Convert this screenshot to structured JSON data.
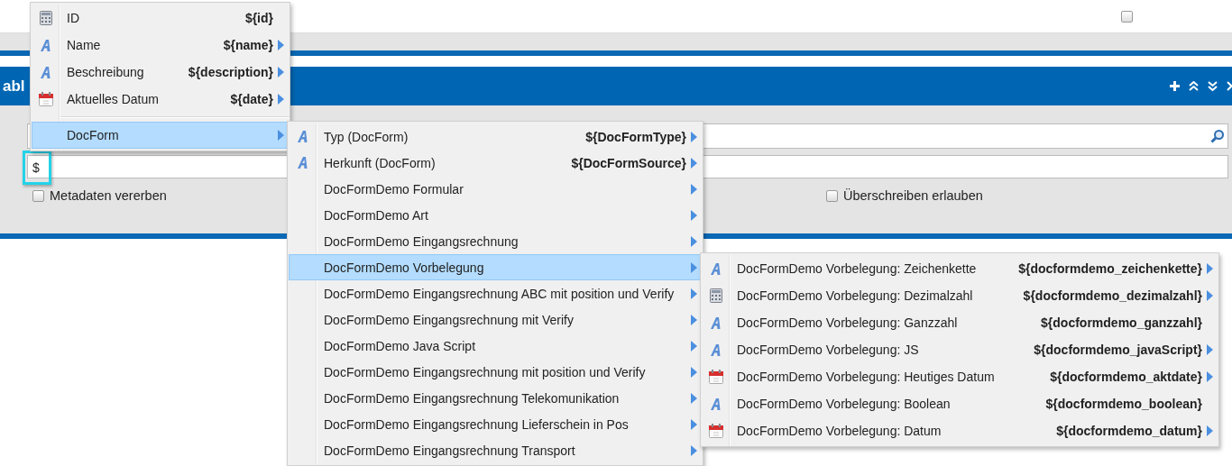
{
  "top_row": {
    "checked": false
  },
  "panel": {
    "title": "abl",
    "expression_field": {
      "value": "$",
      "focused": true
    },
    "checkboxes": [
      {
        "label": "Metadaten vererben",
        "checked": false
      },
      {
        "label": "Überschreiben erlauben",
        "checked": false
      }
    ]
  },
  "menus": [
    {
      "sections": [
        [
          {
            "kind": "number",
            "label": "ID",
            "value": "${id}",
            "has_submenu": false,
            "selected": false
          },
          {
            "kind": "text",
            "label": "Name",
            "value": "${name}",
            "has_submenu": true,
            "selected": false
          },
          {
            "kind": "text",
            "label": "Beschreibung",
            "value": "${description}",
            "has_submenu": true,
            "selected": false
          },
          {
            "kind": "date",
            "label": "Aktuelles Datum",
            "value": "${date}",
            "has_submenu": true,
            "selected": false
          }
        ],
        [
          {
            "kind": "group",
            "label": "DocForm",
            "has_submenu": true,
            "selected": true
          }
        ]
      ]
    },
    {
      "sections": [
        [
          {
            "kind": "text",
            "label": "Typ (DocForm)",
            "value": "${DocFormType}",
            "has_submenu": true,
            "selected": false
          },
          {
            "kind": "text",
            "label": "Herkunft (DocForm)",
            "value": "${DocFormSource}",
            "has_submenu": true,
            "selected": false
          },
          {
            "kind": "group",
            "label": "DocFormDemo Formular",
            "has_submenu": true,
            "selected": false
          },
          {
            "kind": "group",
            "label": "DocFormDemo Art",
            "has_submenu": true,
            "selected": false
          },
          {
            "kind": "group",
            "label": "DocFormDemo Eingangsrechnung",
            "has_submenu": true,
            "selected": false
          },
          {
            "kind": "group",
            "label": "DocFormDemo Vorbelegung",
            "has_submenu": true,
            "selected": true
          },
          {
            "kind": "group",
            "label": "DocFormDemo Eingangsrechnung ABC mit position und Verify",
            "has_submenu": true,
            "selected": false
          },
          {
            "kind": "group",
            "label": "DocFormDemo Eingangsrechnung mit Verify",
            "has_submenu": true,
            "selected": false
          },
          {
            "kind": "group",
            "label": "DocFormDemo Java Script",
            "has_submenu": true,
            "selected": false
          },
          {
            "kind": "group",
            "label": "DocFormDemo Eingangsrechnung mit position und Verify",
            "has_submenu": true,
            "selected": false
          },
          {
            "kind": "group",
            "label": "DocFormDemo Eingangsrechnung Telekomunikation",
            "has_submenu": true,
            "selected": false
          },
          {
            "kind": "group",
            "label": "DocFormDemo Eingangsrechnung Lieferschein in Pos",
            "has_submenu": true,
            "selected": false
          },
          {
            "kind": "group",
            "label": "DocFormDemo Eingangsrechnung Transport",
            "has_submenu": true,
            "selected": false
          }
        ]
      ]
    },
    {
      "sections": [
        [
          {
            "kind": "text",
            "label": "DocFormDemo Vorbelegung: Zeichenkette",
            "value": "${docformdemo_zeichenkette}",
            "has_submenu": true,
            "selected": false
          },
          {
            "kind": "number",
            "label": "DocFormDemo Vorbelegung: Dezimalzahl",
            "value": "${docformdemo_dezimalzahl}",
            "has_submenu": true,
            "selected": false
          },
          {
            "kind": "text",
            "label": "DocFormDemo Vorbelegung: Ganzzahl",
            "value": "${docformdemo_ganzzahl}",
            "has_submenu": false,
            "selected": false
          },
          {
            "kind": "text",
            "label": "DocFormDemo Vorbelegung: JS",
            "value": "${docformdemo_javaScript}",
            "has_submenu": true,
            "selected": false
          },
          {
            "kind": "date",
            "label": "DocFormDemo Vorbelegung: Heutiges Datum",
            "value": "${docformdemo_aktdate}",
            "has_submenu": true,
            "selected": false
          },
          {
            "kind": "text",
            "label": "DocFormDemo Vorbelegung: Boolean",
            "value": "${docformdemo_boolean}",
            "has_submenu": false,
            "selected": false
          },
          {
            "kind": "date",
            "label": "DocFormDemo Vorbelegung: Datum",
            "value": "${docformdemo_datum}",
            "has_submenu": true,
            "selected": false
          }
        ]
      ]
    }
  ]
}
